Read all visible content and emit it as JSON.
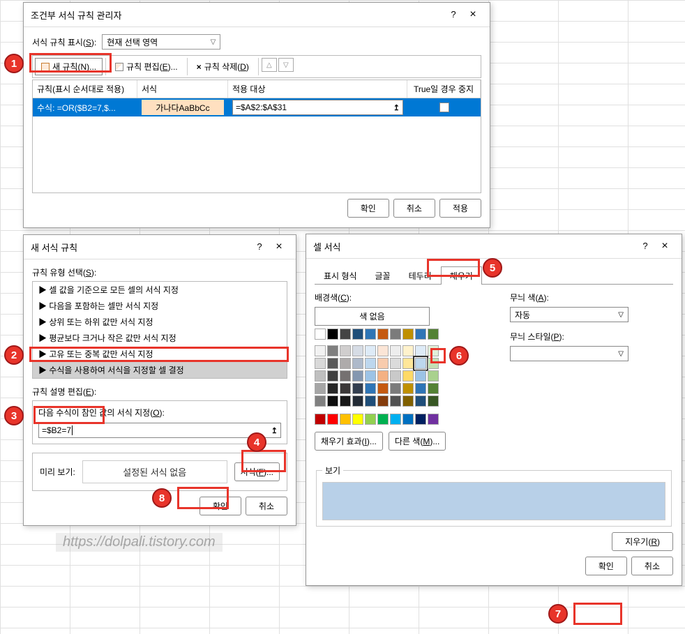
{
  "dlg1": {
    "title": "조건부 서식 규칙 관리자",
    "show_label_pre": "서식 규칙 표시(",
    "show_label_key": "S",
    "show_label_post": "):",
    "scope": "현재 선택 영역",
    "new_rule_pre": "새 규칙(",
    "new_rule_key": "N",
    "new_rule_post": ")...",
    "edit_rule_pre": "규칙 편집(",
    "edit_rule_key": "E",
    "edit_rule_post": ")...",
    "del_rule_pre": "규칙 삭제(",
    "del_rule_key": "D",
    "del_rule_post": ")",
    "hdr_rule": "규칙(표시 순서대로 적용)",
    "hdr_fmt": "서식",
    "hdr_range": "적용 대상",
    "hdr_stop": "True일 경우 중지",
    "rule_text": "수식: =OR($B2=7,$...",
    "fmt_preview": "가나다AaBbCc",
    "applies_to": "=$A$2:$A$31",
    "ok": "확인",
    "cancel": "취소",
    "apply": "적용"
  },
  "dlg2": {
    "title": "새 서식 규칙",
    "type_label_pre": "규칙 유형 선택(",
    "type_label_key": "S",
    "type_label_post": "):",
    "types": [
      "▶ 셀 값을 기준으로 모든 셀의 서식 지정",
      "▶ 다음을 포함하는 셀만 서식 지정",
      "▶ 상위 또는 하위 값만 서식 지정",
      "▶ 평균보다 크거나 작은 값만 서식 지정",
      "▶ 고유 또는 중복 값만 서식 지정",
      "▶ 수식을 사용하여 서식을 지정할 셀 결정"
    ],
    "edit_label_pre": "규칙 설명 편집(",
    "edit_label_key": "E",
    "edit_label_post": "):",
    "formula_label_pre": "다음 수식이 참인 값의 서식 지정(",
    "formula_label_key": "O",
    "formula_label_post": "):",
    "formula": "=$B2=7",
    "preview_label": "미리 보기:",
    "preview_text": "설정된 서식 없음",
    "fmt_btn_pre": "서식(",
    "fmt_btn_key": "F",
    "fmt_btn_post": ")...",
    "ok": "확인",
    "cancel": "취소"
  },
  "dlg3": {
    "title": "셀 서식",
    "tabs": {
      "t1": "표시 형식",
      "t2": "글꼴",
      "t3": "테두리",
      "t4": "채우기"
    },
    "bg_label_pre": "배경색(",
    "bg_label_key": "C",
    "bg_label_post": "):",
    "nocolor": "색 없음",
    "pattern_color_pre": "무늬 색(",
    "pattern_color_key": "A",
    "pattern_color_post": "):",
    "auto": "자동",
    "pattern_style_pre": "무늬 스타일(",
    "pattern_style_key": "P",
    "pattern_style_post": "):",
    "fill_effects_pre": "채우기 효과(",
    "fill_effects_key": "I",
    "fill_effects_post": "...",
    "more_colors_pre": "다른 색(",
    "more_colors_key": "M",
    "more_colors_post": ")...",
    "preview_label": "보기",
    "clear_pre": "지우기(",
    "clear_key": "R",
    "clear_post": ")",
    "ok": "확인",
    "cancel": "취소",
    "selected_color": "#b8d0e8"
  },
  "colors": {
    "theme_row1": [
      "#ffffff",
      "#000000",
      "#444444",
      "#1f4e79",
      "#2e75b6",
      "#c55a11",
      "#7b7b7b",
      "#bf9000",
      "#2f75b6",
      "#548235"
    ],
    "theme_tints": [
      [
        "#f2f2f2",
        "#7f7f7f",
        "#d0cece",
        "#d6dce5",
        "#deebf7",
        "#fbe5d6",
        "#ededed",
        "#fff2cc",
        "#deebf7",
        "#e2f0d9"
      ],
      [
        "#d9d9d9",
        "#595959",
        "#aeabab",
        "#adb9ca",
        "#bdd7ee",
        "#f8cbad",
        "#dbdbdb",
        "#ffe699",
        "#bdd7ee",
        "#c5e0b4"
      ],
      [
        "#bfbfbf",
        "#404040",
        "#757171",
        "#8497b0",
        "#9cc3e6",
        "#f4b183",
        "#c9c9c9",
        "#ffd966",
        "#9cc3e6",
        "#a9d18e"
      ],
      [
        "#a6a6a6",
        "#262626",
        "#3b3838",
        "#333f50",
        "#2e75b6",
        "#c55a11",
        "#7b7b7b",
        "#bf9000",
        "#2e75b6",
        "#548235"
      ],
      [
        "#808080",
        "#0d0d0d",
        "#171717",
        "#222a35",
        "#1f4e79",
        "#843c0c",
        "#525252",
        "#806000",
        "#1f4e79",
        "#385724"
      ]
    ],
    "standard": [
      "#c00000",
      "#ff0000",
      "#ffc000",
      "#ffff00",
      "#92d050",
      "#00b050",
      "#00b0f0",
      "#0070c0",
      "#002060",
      "#7030a0"
    ]
  },
  "watermark": "https://dolpali.tistory.com",
  "numbers": {
    "n1": "1",
    "n2": "2",
    "n3": "3",
    "n4": "4",
    "n5": "5",
    "n6": "6",
    "n7": "7",
    "n8": "8"
  }
}
